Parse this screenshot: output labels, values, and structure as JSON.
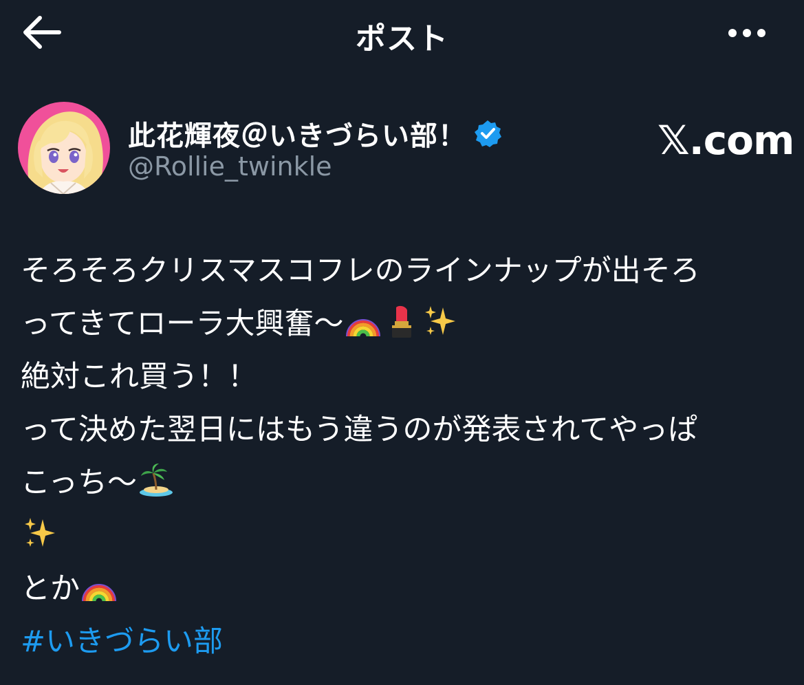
{
  "header": {
    "title": "ポスト",
    "back_icon": "back-arrow-icon",
    "more_icon": "more-horizontal-icon"
  },
  "author": {
    "display_name": "此花輝夜＠いきづらい部！",
    "handle": "@Rollie_twinkle",
    "verified_icon": "verified-badge-icon",
    "verified_color": "#1d9bf0",
    "avatar_bg": "#f0509a"
  },
  "watermark": "𝕏.com",
  "post": {
    "lines": [
      "そろそろクリスマスコフレのラインナップが出そろ",
      "ってきてローラ大興奮〜",
      "絶対これ買う！！",
      "って決めた翌日にはもう違うのが発表されてやっぱ",
      "こっち〜",
      "",
      "とか"
    ],
    "hashtag": "#いきづらい部",
    "emojis": [
      "rainbow-icon",
      "lipstick-icon",
      "sparkles-icon",
      "desert-island-icon"
    ]
  },
  "colors": {
    "background": "#151d28",
    "text": "#ffffff",
    "secondary": "#8b98a5",
    "link": "#1d9bf0"
  }
}
